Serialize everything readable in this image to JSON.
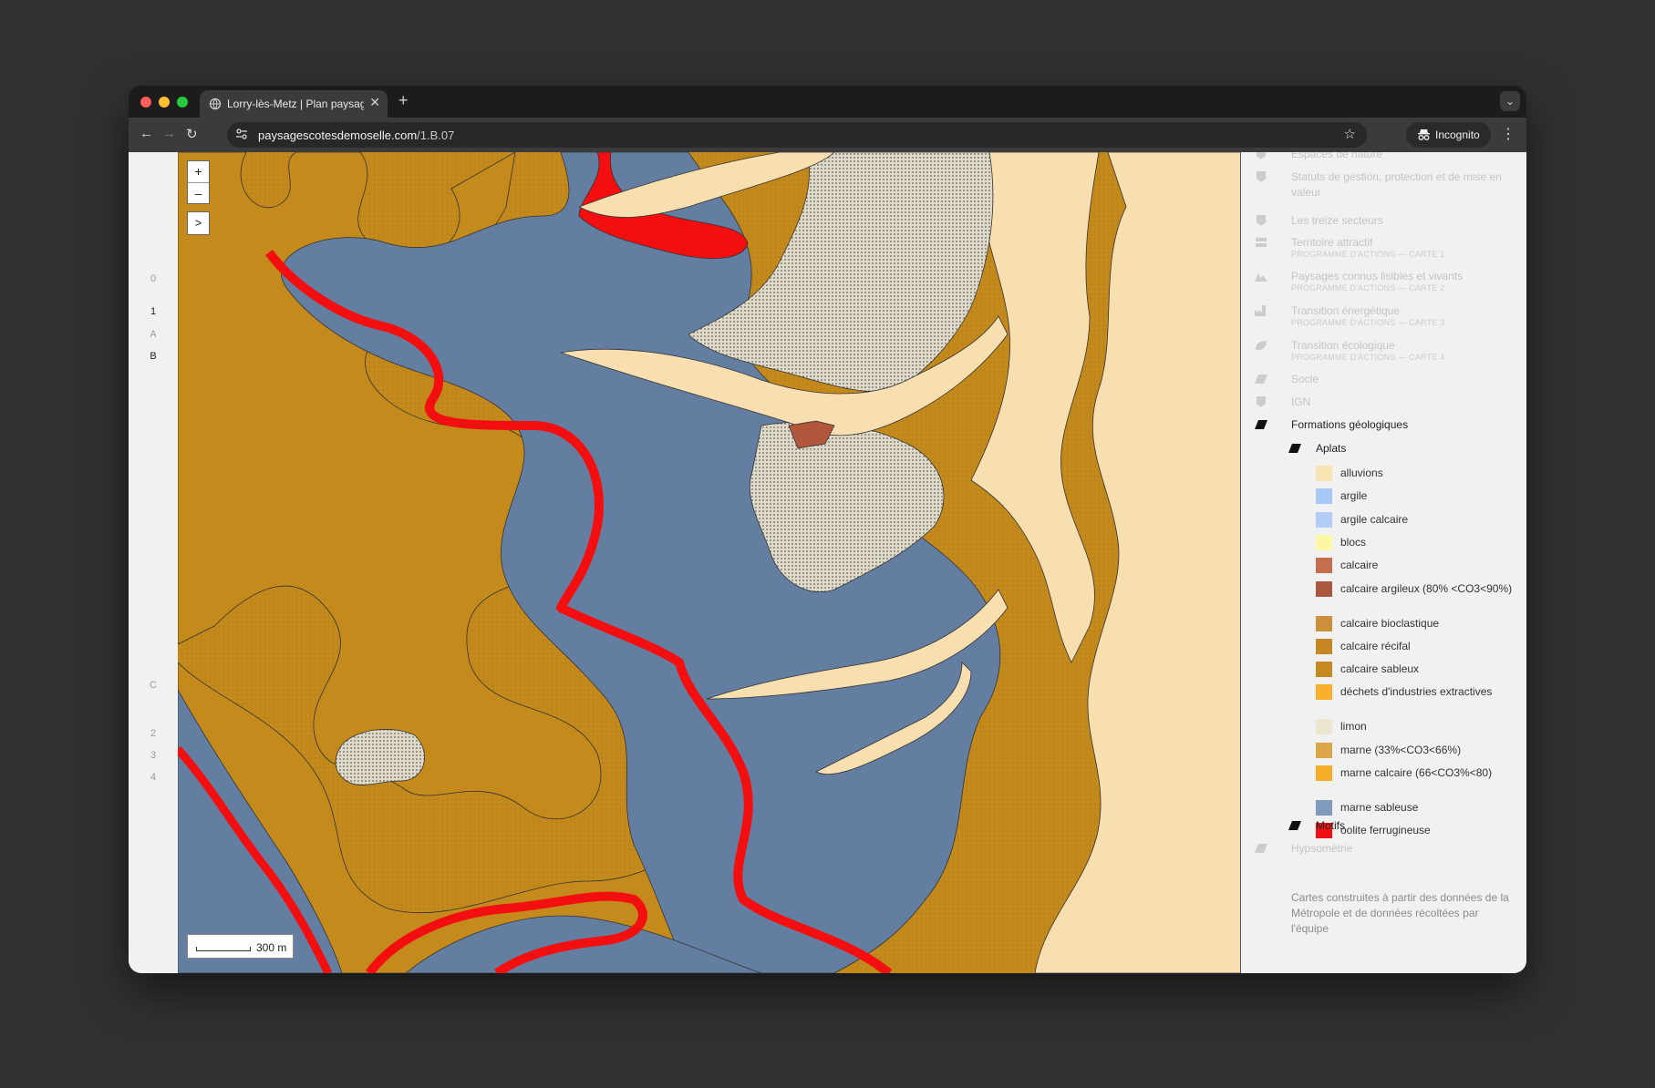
{
  "browser": {
    "tab_title": "Lorry-lès-Metz | Plan paysage",
    "url_domain": "paysagescotesdemoselle.com",
    "url_path": "/1.B.07",
    "incognito_label": "Incognito"
  },
  "index_nav": {
    "zero": "0",
    "one": "1",
    "a": "A",
    "b": "B",
    "c": "C",
    "two": "2",
    "three": "3",
    "four": "4"
  },
  "map": {
    "zoom_in": "+",
    "zoom_out": "–",
    "expand": ">",
    "scale_label": "300 m",
    "colors": {
      "tan": "#c58a1c",
      "cream": "#f7dfb0",
      "blue": "#637ea0",
      "red": "#f30f0f",
      "silt": "#dedac7",
      "brown": "#b2573c"
    }
  },
  "layers": {
    "espaces_nature": "Espaces de nature",
    "statuts": "Statuts de gestion, protection et de mise en valeur",
    "treize_secteurs": "Les treize secteurs",
    "territoire": "Territoire attractif",
    "territoire_sub": "PROGRAMME D'ACTIONS — CARTE 1",
    "paysages": "Paysages connus lisibles et vivants",
    "paysages_sub": "PROGRAMME D'ACTIONS — CARTE 2",
    "transition_energetique": "Transition énergétique",
    "transition_energetique_sub": "PROGRAMME D'ACTIONS — CARTE 3",
    "transition_ecologique": "Transition écologique",
    "transition_ecologique_sub": "PROGRAMME D'ACTIONS — CARTE 4",
    "socle": "Socle",
    "ign": "IGN",
    "formations": "Formations géologiques",
    "aplats": "Aplats",
    "motifs": "Motifs",
    "hypsometrie": "Hypsométrie"
  },
  "legend": [
    {
      "label": "alluvions",
      "color": "#f9e3b2"
    },
    {
      "label": "argile",
      "color": "#a8c8f5"
    },
    {
      "label": "argile calcaire",
      "color": "#b4cdf8"
    },
    {
      "label": "blocs",
      "color": "#fbf7a4"
    },
    {
      "label": "calcaire",
      "color": "#c56e4e"
    },
    {
      "label": "calcaire argileux (80% <CO3<90%)",
      "color": "#a9583d"
    },
    {
      "label": "calcaire bioclastique",
      "color": "#cc903a"
    },
    {
      "label": "calcaire récifal",
      "color": "#c48724"
    },
    {
      "label": "calcaire sableux",
      "color": "#c4891f"
    },
    {
      "label": "déchets d'industries extractives",
      "color": "#f8ad2b"
    },
    {
      "label": "limon",
      "color": "#ebe6cf"
    },
    {
      "label": "marne (33%<CO3<66%)",
      "color": "#dea449"
    },
    {
      "label": "marne calcaire (66<CO3%<80)",
      "color": "#f5ac27"
    },
    {
      "label": "marne sableuse",
      "color": "#7f9cbd"
    },
    {
      "label": "oolite ferrugineuse",
      "color": "#f00f12"
    }
  ],
  "credit": "Cartes construites à partir des données de la Métropole et de données récoltées par l'équipe"
}
